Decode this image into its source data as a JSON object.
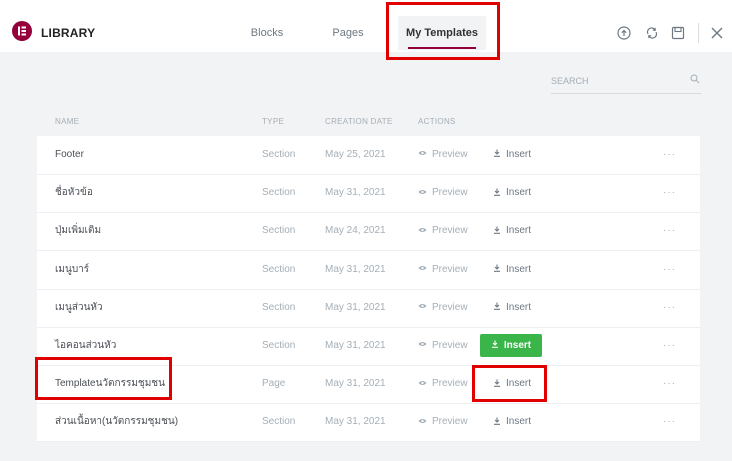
{
  "header": {
    "logo_icon": "elementor-logo-icon",
    "title": "LIBRARY",
    "tabs": [
      {
        "label": "Blocks",
        "active": false
      },
      {
        "label": "Pages",
        "active": false
      },
      {
        "label": "My Templates",
        "active": true
      }
    ],
    "accent_color": "#93003c",
    "icons": [
      "upload-icon",
      "sync-icon",
      "save-icon",
      "close-icon"
    ]
  },
  "search": {
    "placeholder": "SEARCH"
  },
  "columns": {
    "name": "NAME",
    "type": "TYPE",
    "creation_date": "CREATION DATE",
    "actions": "ACTIONS"
  },
  "actions": {
    "preview": "Preview",
    "insert": "Insert",
    "more": "···"
  },
  "rows": [
    {
      "name": "Footer",
      "type": "Section",
      "date": "May 25, 2021"
    },
    {
      "name": "ชื่อหัวข้อ",
      "type": "Section",
      "date": "May 31, 2021"
    },
    {
      "name": "ปุ่มเพิ่มเติม",
      "type": "Section",
      "date": "May 24, 2021"
    },
    {
      "name": "เมนูบาร์",
      "type": "Section",
      "date": "May 31, 2021"
    },
    {
      "name": "เมนูส่วนหัว",
      "type": "Section",
      "date": "May 31, 2021"
    },
    {
      "name": "ไอคอนส่วนหัว",
      "type": "Section",
      "date": "May 31, 2021",
      "hover": true
    },
    {
      "name": "Templateนวัตกรรมชุมชน",
      "type": "Page",
      "date": "May 31, 2021"
    },
    {
      "name": "ส่วนเนื้อหา(นวัตกรรมชุมชน)",
      "type": "Section",
      "date": "May 31, 2021"
    }
  ],
  "insert_button_color": "#39b54a",
  "highlight_color": "#e00000"
}
